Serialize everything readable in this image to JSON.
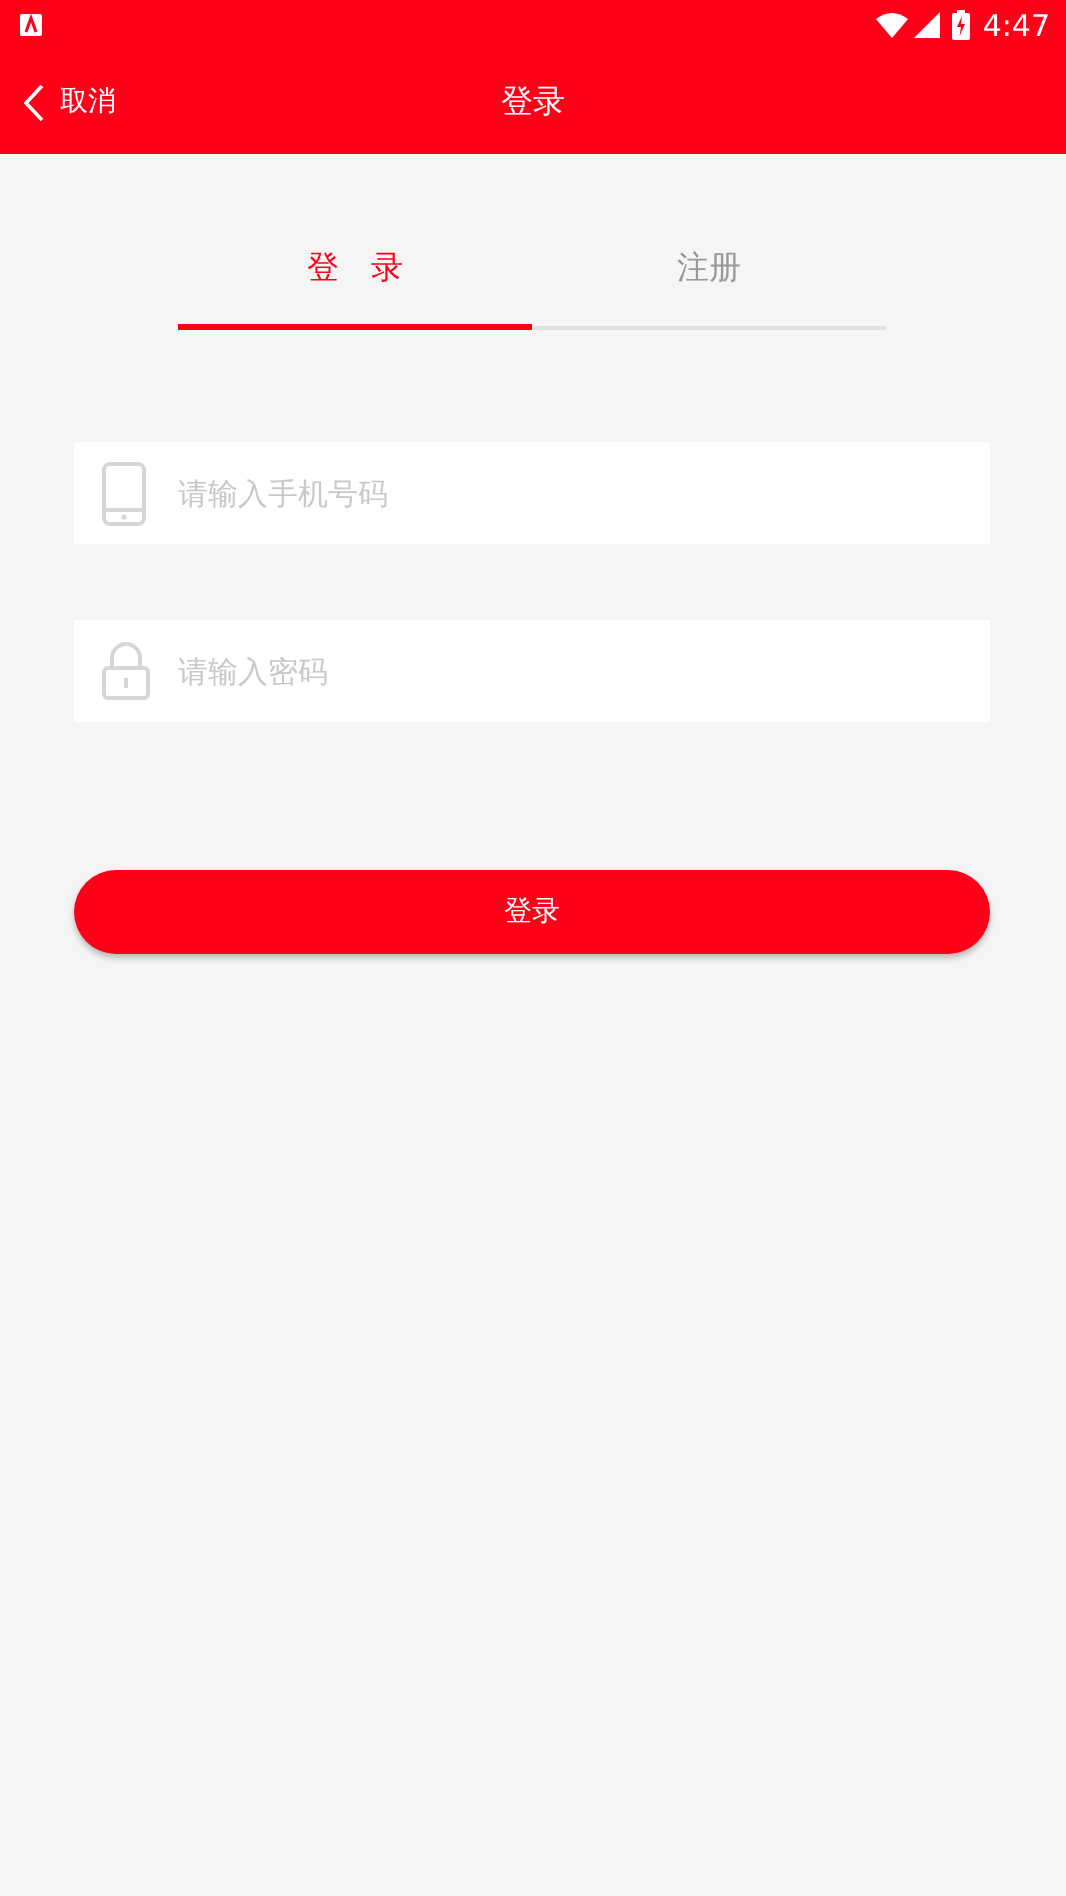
{
  "status_bar": {
    "time": "4:47"
  },
  "header": {
    "back_label": "取消",
    "title": "登录"
  },
  "tabs": [
    {
      "label": "登　录",
      "selected": true
    },
    {
      "label": "注册",
      "selected": false
    }
  ],
  "fields": [
    {
      "kind": "phone",
      "placeholder": "请输入手机号码"
    },
    {
      "kind": "password",
      "placeholder": "请输入密码"
    }
  ],
  "submit_button": "登录"
}
